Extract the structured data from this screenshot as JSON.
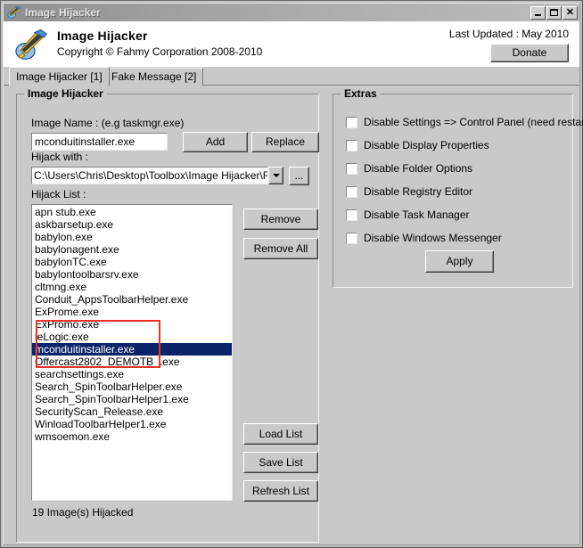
{
  "window": {
    "title": "Image Hijacker",
    "icon": "app-wand-icon",
    "controls": {
      "minimize": "_",
      "maximize": "□",
      "close": "✕"
    }
  },
  "header": {
    "app_name": "Image Hijacker",
    "copyright": "Copyright © Fahmy Corporation 2008-2010",
    "last_updated": "Last Updated : May 2010",
    "donate_label": "Donate"
  },
  "tabs": [
    {
      "label": "Image Hijacker [1]",
      "active": true
    },
    {
      "label": "Fake Message [2]",
      "active": false
    }
  ],
  "main_group": {
    "title": "Image Hijacker",
    "image_name_label": "Image Name : (e.g taskmgr.exe)",
    "image_name_value": "mconduitinstaller.exe",
    "add_label": "Add",
    "replace_label": "Replace",
    "hijack_with_label": "Hijack with :",
    "hijack_with_value": "C:\\Users\\Chris\\Desktop\\Toolbox\\Image Hijacker\\FM.ex",
    "browse_label": "...",
    "hijack_list_label": "Hijack List :",
    "remove_label": "Remove",
    "remove_all_label": "Remove All",
    "load_list_label": "Load List",
    "save_list_label": "Save List",
    "refresh_list_label": "Refresh List",
    "status": "19 Image(s) Hijacked",
    "selected_item": "mconduitinstaller.exe",
    "list_items": [
      "apn stub.exe",
      "askbarsetup.exe",
      "babylon.exe",
      "babylonagent.exe",
      "babylonTC.exe",
      "babylontoolbarsrv.exe",
      "cltmng.exe",
      "Conduit_AppsToolbarHelper.exe",
      "ExProme.exe",
      "ExPromo.exe",
      "ieLogic.exe",
      "mconduitinstaller.exe",
      "Offercast2802_DEMOTB_.exe",
      "searchsettings.exe",
      "Search_SpinToolbarHelper.exe",
      "Search_SpinToolbarHelper1.exe",
      "SecurityScan_Release.exe",
      "WinloadToolbarHelper1.exe",
      "wmsoemon.exe"
    ]
  },
  "extras": {
    "title": "Extras",
    "apply_label": "Apply",
    "options": [
      {
        "label": "Disable Settings => Control Panel (need restart)",
        "checked": false
      },
      {
        "label": "Disable Display Properties",
        "checked": false
      },
      {
        "label": "Disable Folder Options",
        "checked": false
      },
      {
        "label": "Disable Registry Editor",
        "checked": false
      },
      {
        "label": "Disable Task Manager",
        "checked": false
      },
      {
        "label": "Disable Windows Messenger",
        "checked": false
      }
    ]
  },
  "annotation": {
    "highlight_color": "#ef3124"
  }
}
